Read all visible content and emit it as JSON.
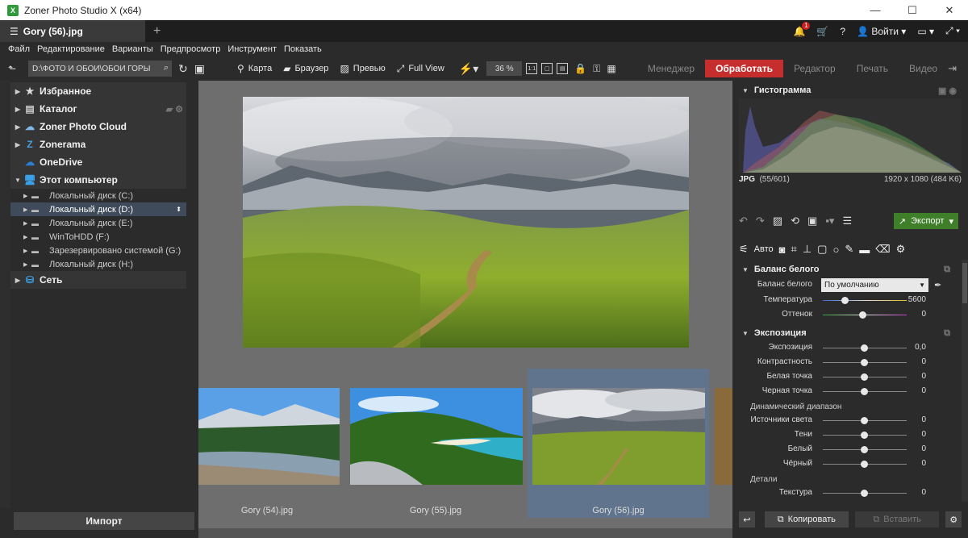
{
  "window": {
    "title": "Zoner Photo Studio X (x64)",
    "app_badge": "X"
  },
  "tab": {
    "label": "Gory (56).jpg",
    "add": "+"
  },
  "topbar": {
    "notif_count": "1",
    "login_label": "Войти"
  },
  "menu": [
    "Файл",
    "Редактирование",
    "Варианты",
    "Предпросмотр",
    "Инструмент",
    "Показать"
  ],
  "toolbar": {
    "path": "D:\\ФОТО И ОБОИ\\ОБОИ ГОРЫ",
    "map_label": "Карта",
    "browser_label": "Браузер",
    "preview_label": "Превью",
    "fullview_label": "Full View",
    "zoom": "36 %"
  },
  "modes": {
    "manager": "Менеджер",
    "process": "Обработать",
    "editor": "Редактор",
    "print": "Печать",
    "video": "Видео"
  },
  "tree": {
    "top": [
      {
        "label": "Избранное",
        "icon": "star-icon"
      },
      {
        "label": "Каталог",
        "icon": "catalog-icon"
      },
      {
        "label": "Zoner Photo Cloud",
        "icon": "cloud-icon"
      },
      {
        "label": "Zonerama",
        "icon": "zonerama-icon"
      },
      {
        "label": "OneDrive",
        "icon": "onedrive-icon"
      },
      {
        "label": "Этот компьютер",
        "icon": "computer-icon"
      }
    ],
    "drives": [
      "Локальный диск (C:)",
      "Локальный диск (D:)",
      "Локальный диск (E:)",
      "WinToHDD (F:)",
      "Зарезервировано системой (G:)",
      "Локальный диск (H:)"
    ],
    "network": "Сеть"
  },
  "import_label": "Импорт",
  "thumbnails": [
    {
      "caption": "Gory (54).jpg"
    },
    {
      "caption": "Gory (55).jpg"
    },
    {
      "caption": "Gory (56).jpg",
      "selected": true
    }
  ],
  "histogram": {
    "title": "Гистограмма",
    "format": "JPG",
    "index": "(55/601)",
    "dims": "1920 x 1080 (484 K6)"
  },
  "export_label": "Экспорт",
  "auto_label": "Авто",
  "white_balance": {
    "title": "Баланс белого",
    "mode_label": "Баланс белого",
    "mode_value": "По умолчанию",
    "temp_label": "Температура",
    "temp_value": "5600",
    "tint_label": "Оттенок",
    "tint_value": "0"
  },
  "exposure": {
    "title": "Экспозиция",
    "params": [
      {
        "label": "Экспозиция",
        "value": "0,0"
      },
      {
        "label": "Контрастность",
        "value": "0"
      },
      {
        "label": "Белая точка",
        "value": "0"
      },
      {
        "label": "Черная точка",
        "value": "0"
      }
    ],
    "dynamic_title": "Динамический диапазон",
    "dynamic": [
      {
        "label": "Источники света",
        "value": "0"
      },
      {
        "label": "Тени",
        "value": "0"
      },
      {
        "label": "Белый",
        "value": "0"
      },
      {
        "label": "Чёрный",
        "value": "0"
      }
    ],
    "details_title": "Детали",
    "details": [
      {
        "label": "Текстура",
        "value": "0"
      }
    ]
  },
  "bottom": {
    "copy_label": "Копировать",
    "paste_label": "Вставить"
  }
}
